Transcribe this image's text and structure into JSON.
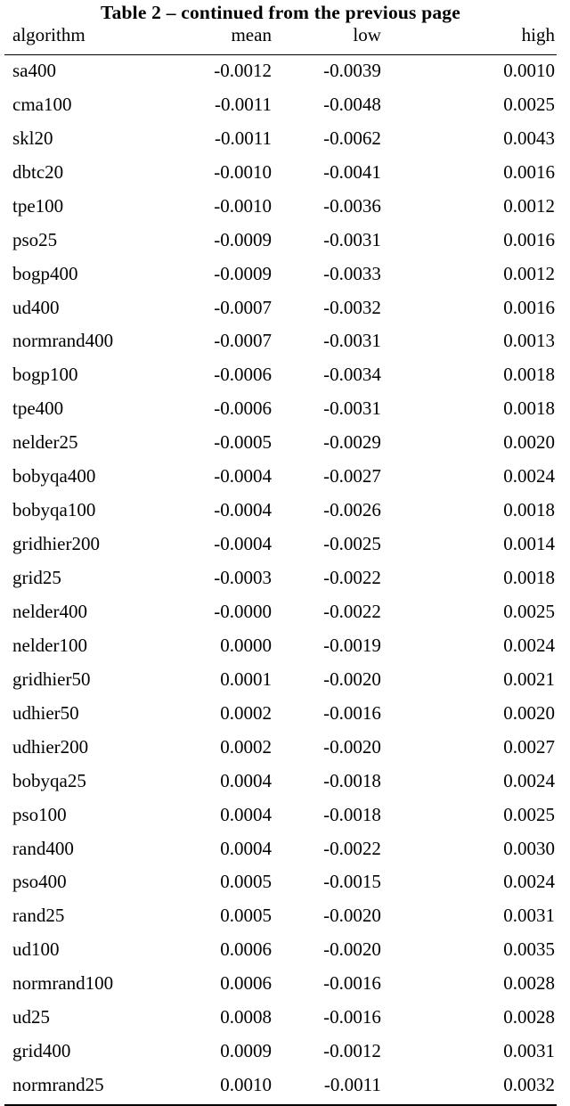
{
  "caption": "Table 2 – continued from the previous page",
  "table": {
    "columns": [
      {
        "key": "algorithm",
        "label": "algorithm",
        "align": "left"
      },
      {
        "key": "mean",
        "label": "mean",
        "align": "right"
      },
      {
        "key": "low",
        "label": "low",
        "align": "right"
      },
      {
        "key": "high",
        "label": "high",
        "align": "right"
      }
    ],
    "rows": [
      {
        "algorithm": "sa400",
        "mean": "-0.0012",
        "low": "-0.0039",
        "high": "0.0010"
      },
      {
        "algorithm": "cma100",
        "mean": "-0.0011",
        "low": "-0.0048",
        "high": "0.0025"
      },
      {
        "algorithm": "skl20",
        "mean": "-0.0011",
        "low": "-0.0062",
        "high": "0.0043"
      },
      {
        "algorithm": "dbtc20",
        "mean": "-0.0010",
        "low": "-0.0041",
        "high": "0.0016"
      },
      {
        "algorithm": "tpe100",
        "mean": "-0.0010",
        "low": "-0.0036",
        "high": "0.0012"
      },
      {
        "algorithm": "pso25",
        "mean": "-0.0009",
        "low": "-0.0031",
        "high": "0.0016"
      },
      {
        "algorithm": "bogp400",
        "mean": "-0.0009",
        "low": "-0.0033",
        "high": "0.0012"
      },
      {
        "algorithm": "ud400",
        "mean": "-0.0007",
        "low": "-0.0032",
        "high": "0.0016"
      },
      {
        "algorithm": "normrand400",
        "mean": "-0.0007",
        "low": "-0.0031",
        "high": "0.0013"
      },
      {
        "algorithm": "bogp100",
        "mean": "-0.0006",
        "low": "-0.0034",
        "high": "0.0018"
      },
      {
        "algorithm": "tpe400",
        "mean": "-0.0006",
        "low": "-0.0031",
        "high": "0.0018"
      },
      {
        "algorithm": "nelder25",
        "mean": "-0.0005",
        "low": "-0.0029",
        "high": "0.0020"
      },
      {
        "algorithm": "bobyqa400",
        "mean": "-0.0004",
        "low": "-0.0027",
        "high": "0.0024"
      },
      {
        "algorithm": "bobyqa100",
        "mean": "-0.0004",
        "low": "-0.0026",
        "high": "0.0018"
      },
      {
        "algorithm": "gridhier200",
        "mean": "-0.0004",
        "low": "-0.0025",
        "high": "0.0014"
      },
      {
        "algorithm": "grid25",
        "mean": "-0.0003",
        "low": "-0.0022",
        "high": "0.0018"
      },
      {
        "algorithm": "nelder400",
        "mean": "-0.0000",
        "low": "-0.0022",
        "high": "0.0025"
      },
      {
        "algorithm": "nelder100",
        "mean": "0.0000",
        "low": "-0.0019",
        "high": "0.0024"
      },
      {
        "algorithm": "gridhier50",
        "mean": "0.0001",
        "low": "-0.0020",
        "high": "0.0021"
      },
      {
        "algorithm": "udhier50",
        "mean": "0.0002",
        "low": "-0.0016",
        "high": "0.0020"
      },
      {
        "algorithm": "udhier200",
        "mean": "0.0002",
        "low": "-0.0020",
        "high": "0.0027"
      },
      {
        "algorithm": "bobyqa25",
        "mean": "0.0004",
        "low": "-0.0018",
        "high": "0.0024"
      },
      {
        "algorithm": "pso100",
        "mean": "0.0004",
        "low": "-0.0018",
        "high": "0.0025"
      },
      {
        "algorithm": "rand400",
        "mean": "0.0004",
        "low": "-0.0022",
        "high": "0.0030"
      },
      {
        "algorithm": "pso400",
        "mean": "0.0005",
        "low": "-0.0015",
        "high": "0.0024"
      },
      {
        "algorithm": "rand25",
        "mean": "0.0005",
        "low": "-0.0020",
        "high": "0.0031"
      },
      {
        "algorithm": "ud100",
        "mean": "0.0006",
        "low": "-0.0020",
        "high": "0.0035"
      },
      {
        "algorithm": "normrand100",
        "mean": "0.0006",
        "low": "-0.0016",
        "high": "0.0028"
      },
      {
        "algorithm": "ud25",
        "mean": "0.0008",
        "low": "-0.0016",
        "high": "0.0028"
      },
      {
        "algorithm": "grid400",
        "mean": "0.0009",
        "low": "-0.0012",
        "high": "0.0031"
      },
      {
        "algorithm": "normrand25",
        "mean": "0.0010",
        "low": "-0.0011",
        "high": "0.0032"
      }
    ]
  }
}
